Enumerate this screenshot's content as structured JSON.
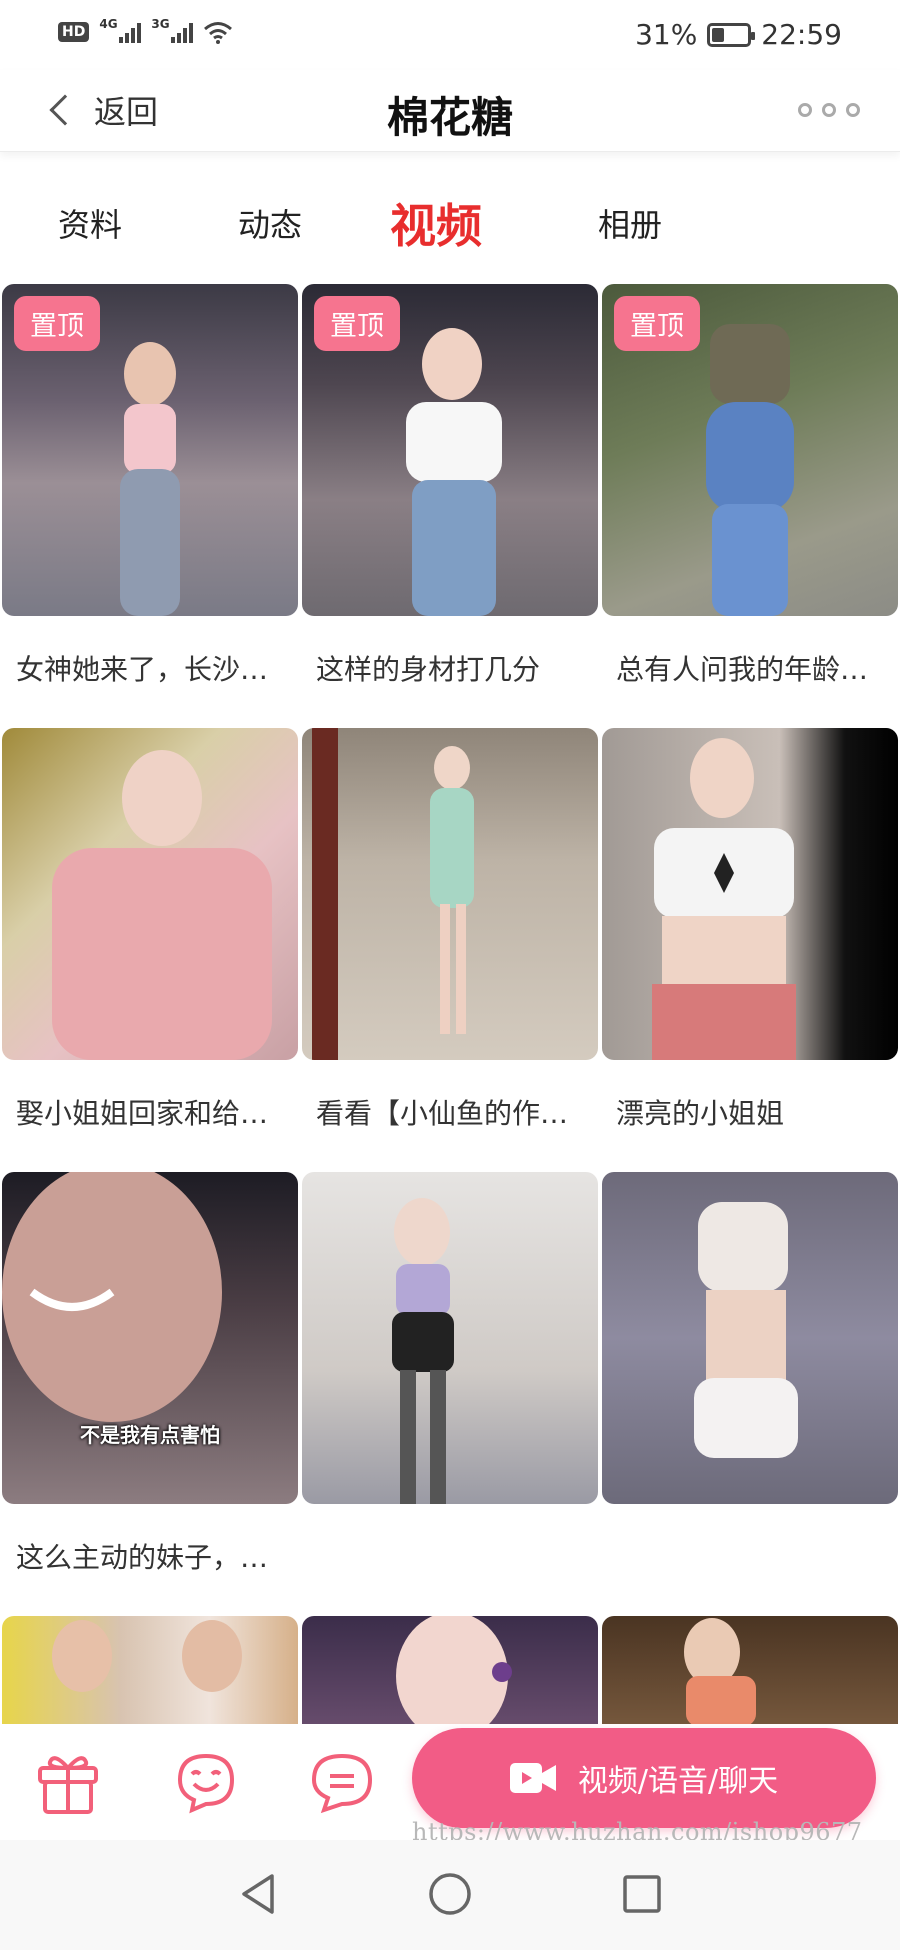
{
  "status_bar": {
    "hd_label": "HD",
    "network_1": "4G",
    "network_2": "3G",
    "battery_percent": "31%",
    "time": "22:59"
  },
  "nav": {
    "back_label": "返回",
    "title": "棉花糖"
  },
  "tabs": [
    {
      "label": "资料",
      "active": false
    },
    {
      "label": "动态",
      "active": false
    },
    {
      "label": "视频",
      "active": true
    },
    {
      "label": "相册",
      "active": false
    }
  ],
  "videos": [
    {
      "caption": "女神她来了，长沙…",
      "pinned": true,
      "pin_label": "置顶"
    },
    {
      "caption": "这样的身材打几分",
      "pinned": true,
      "pin_label": "置顶"
    },
    {
      "caption": "总有人问我的年龄…",
      "pinned": true,
      "pin_label": "置顶"
    },
    {
      "caption": "娶小姐姐回家和给…",
      "pinned": false
    },
    {
      "caption": "看看【小仙鱼的作…",
      "pinned": false
    },
    {
      "caption": "漂亮的小姐姐",
      "pinned": false
    },
    {
      "caption": "这么主动的妹子，…",
      "pinned": false,
      "overlay_text": "不是我有点害怕"
    },
    {
      "caption": "",
      "pinned": false
    },
    {
      "caption": "",
      "pinned": false
    },
    {
      "caption": "",
      "pinned": false
    },
    {
      "caption": "",
      "pinned": false
    },
    {
      "caption": "",
      "pinned": false
    }
  ],
  "bottom_bar": {
    "action_label": "视频/语音/聊天",
    "watermark": "https://www.huzhan.com/ishop9677"
  },
  "colors": {
    "accent_red": "#e82e2e",
    "pink": "#f25c86",
    "pin_badge": "#f6748f"
  }
}
